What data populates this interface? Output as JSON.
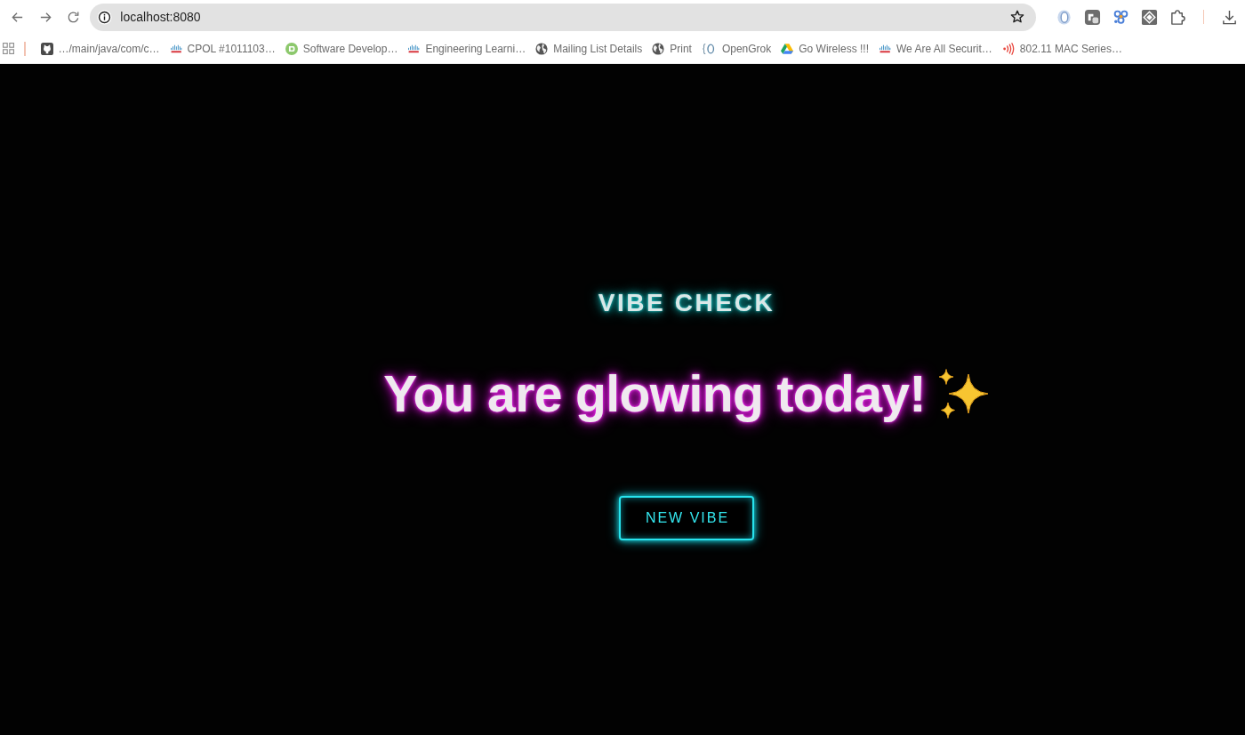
{
  "browser": {
    "address": "localhost:8080",
    "bookmarks": [
      {
        "kind": "cat",
        "label": "…/main/java/com/c…"
      },
      {
        "kind": "bars",
        "label": "CPOL #1011103…"
      },
      {
        "kind": "disc",
        "label": "Software Develop…"
      },
      {
        "kind": "bars",
        "label": "Engineering Learni…"
      },
      {
        "kind": "globe",
        "label": "Mailing List Details"
      },
      {
        "kind": "globe",
        "label": "Print"
      },
      {
        "kind": "brace",
        "label": "OpenGrok"
      },
      {
        "kind": "triangle",
        "label": "Go Wireless !!!"
      },
      {
        "kind": "bars",
        "label": "We Are All Securit…"
      },
      {
        "kind": "signal",
        "label": "802.11 MAC Series…"
      }
    ]
  },
  "page": {
    "eyebrow": "VIBE CHECK",
    "message": "You are glowing today!",
    "button": "NEW VIBE"
  }
}
